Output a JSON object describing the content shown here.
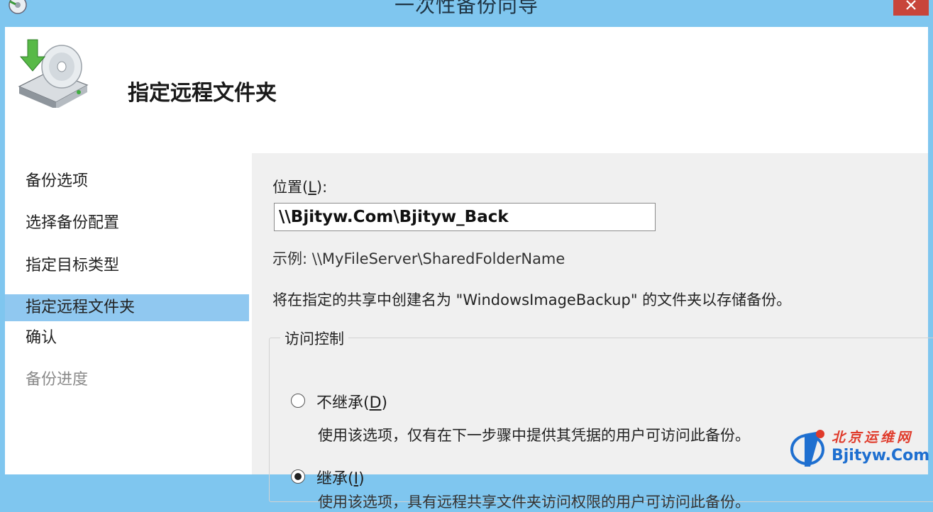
{
  "window": {
    "title": "一次性备份向导"
  },
  "header": {
    "title": "指定远程文件夹",
    "icon": "backup-drive-icon"
  },
  "nav": {
    "items": [
      {
        "label": "备份选项",
        "state": "normal"
      },
      {
        "label": "选择备份配置",
        "state": "normal"
      },
      {
        "label": "指定目标类型",
        "state": "normal"
      },
      {
        "label": "指定远程文件夹",
        "state": "active"
      },
      {
        "label": "确认",
        "state": "normal"
      },
      {
        "label": "备份进度",
        "state": "disabled"
      }
    ]
  },
  "location": {
    "label_pre": "位置(",
    "label_key": "L",
    "label_post": "):",
    "value": "\\\\Bjityw.Com\\Bjityw_Back",
    "example": "示例: \\\\MyFileServer\\SharedFolderName",
    "description": "将在指定的共享中创建名为 \"WindowsImageBackup\" 的文件夹以存储备份。"
  },
  "access_control": {
    "title": "访问控制",
    "options": [
      {
        "label_pre": "不继承(",
        "label_key": "D",
        "label_post": ")",
        "selected": false,
        "description": "使用该选项，仅有在下一步骤中提供其凭据的用户可访问此备份。"
      },
      {
        "label_pre": "继承(",
        "label_key": "I",
        "label_post": ")",
        "selected": true,
        "description": "使用该选项，具有远程共享文件夹访问权限的用户可访问此备份。"
      }
    ]
  },
  "watermark": {
    "cn": "北京运维网",
    "en": "Bjityw.Com"
  },
  "colors": {
    "titlebar": "#7fc6ef",
    "nav_active": "#90c8f0",
    "content_bg": "#f0f0f0",
    "close": "#c8453b"
  }
}
